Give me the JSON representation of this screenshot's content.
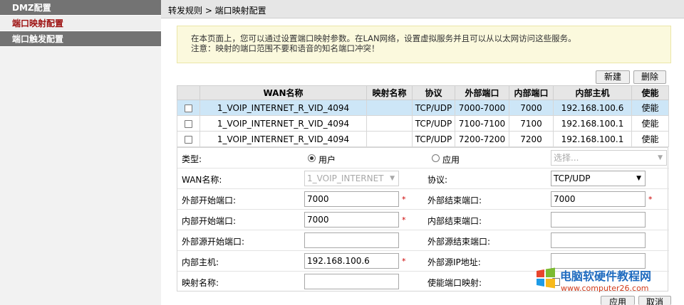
{
  "sidebar": {
    "items": [
      {
        "label": "DMZ配置",
        "state": "grey"
      },
      {
        "label": "端口映射配置",
        "state": "active"
      },
      {
        "label": "端口触发配置",
        "state": "grey"
      }
    ]
  },
  "breadcrumb": "转发规则 > 端口映射配置",
  "info": {
    "line1": "在本页面上，您可以通过设置端口映射参数。在LAN网络，设置虚拟服务并且可以从以太网访问这些服务。",
    "line2": "注意：映射的端口范围不要和语音的知名端口冲突！"
  },
  "toolbar": {
    "new_label": "新建",
    "delete_label": "删除"
  },
  "table": {
    "headers": [
      "",
      "WAN名称",
      "映射名称",
      "协议",
      "外部端口",
      "内部端口",
      "内部主机",
      "使能"
    ],
    "rows": [
      [
        "1_VOIP_INTERNET_R_VID_4094",
        "",
        "TCP/UDP",
        "7000-7000",
        "7000",
        "192.168.100.6",
        "使能"
      ],
      [
        "1_VOIP_INTERNET_R_VID_4094",
        "",
        "TCP/UDP",
        "7100-7100",
        "7100",
        "192.168.100.1",
        "使能"
      ],
      [
        "1_VOIP_INTERNET_R_VID_4094",
        "",
        "TCP/UDP",
        "7200-7200",
        "7200",
        "192.168.100.1",
        "使能"
      ]
    ]
  },
  "form": {
    "type_label": "类型:",
    "type_user": "用户",
    "type_app": "应用",
    "app_select_placeholder": "选择...",
    "wan_label": "WAN名称:",
    "wan_value": "1_VOIP_INTERNET",
    "protocol_label": "协议:",
    "protocol_value": "TCP/UDP",
    "ext_start_label": "外部开始端口:",
    "ext_start_value": "7000",
    "ext_end_label": "外部结束端口:",
    "ext_end_value": "7000",
    "int_start_label": "内部开始端口:",
    "int_start_value": "7000",
    "int_end_label": "内部结束端口:",
    "int_end_value": "",
    "src_start_label": "外部源开始端口:",
    "src_start_value": "",
    "src_end_label": "外部源结束端口:",
    "src_end_value": "",
    "host_label": "内部主机:",
    "host_value": "192.168.100.6",
    "src_ip_label": "外部源IP地址:",
    "src_ip_value": "",
    "map_name_label": "映射名称:",
    "map_name_value": "",
    "enable_label": "使能端口映射:",
    "required": "*"
  },
  "footer": {
    "apply_label": "应用",
    "cancel_label": "取消"
  },
  "watermark": {
    "title": "电脑软硬件教程网",
    "url": "www.computer26.com"
  },
  "colors": {
    "active_side": "#9c0f0f",
    "highlight_row": "#cde6f7",
    "info_bg": "#fbf9dd"
  }
}
